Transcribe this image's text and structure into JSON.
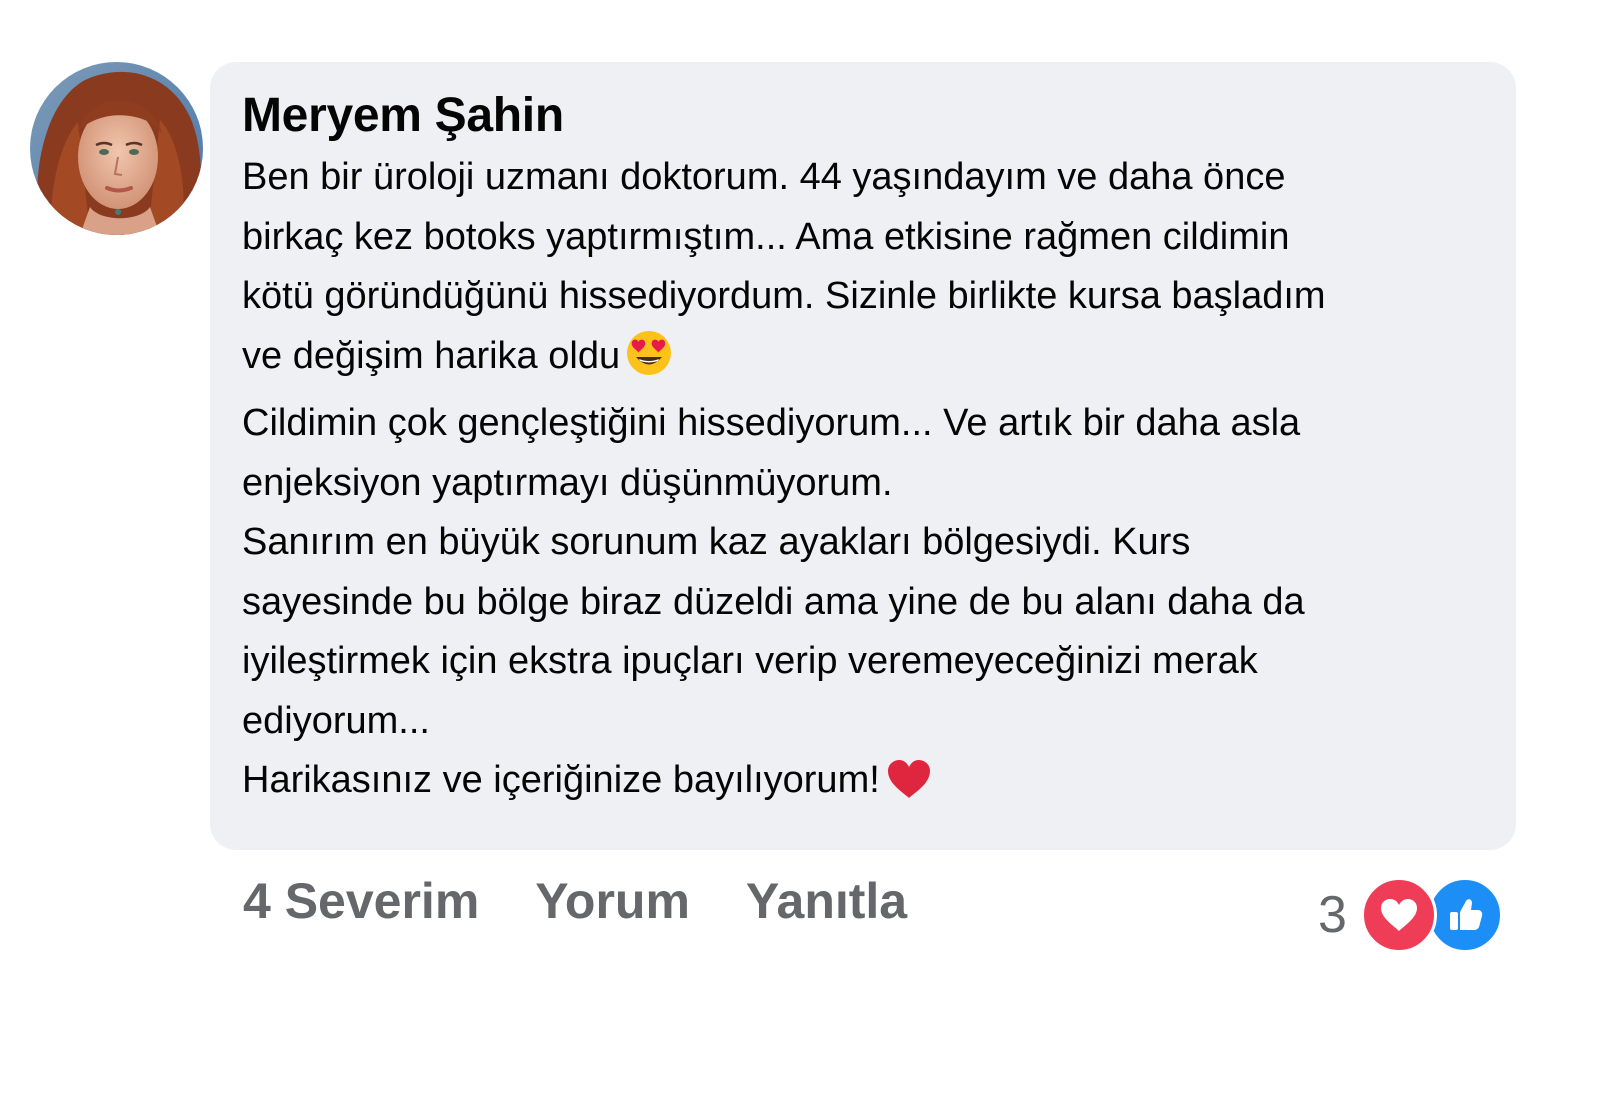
{
  "comment": {
    "author": "Meryem Şahin",
    "lines": [
      "Ben bir üroloji uzmanı doktorum. 44 yaşındayım ve daha önce",
      "birkaç kez botoks yaptırmıştım... Ama etkisine rağmen cildimin",
      "kötü göründüğünü hissediyordum. Sizinle birlikte kursa başladım",
      "ve değişim harika oldu",
      " Cildimin çok gençleştiğini hissediyorum... Ve artık bir daha asla",
      "enjeksiyon yaptırmayı düşünmüyorum.",
      " Sanırım en büyük sorunum kaz ayakları bölgesiydi. Kurs",
      "sayesinde bu bölge biraz düzeldi ama yine de bu alanı daha da",
      "iyileştirmek için ekstra ipuçları verip veremeyeceğinizi merak",
      "ediyorum...",
      "Harikasınız ve içeriğinize bayılıyorum!"
    ],
    "emojis": {
      "line_4": "heart-eyes-emoji",
      "line_11": "red-heart-emoji"
    }
  },
  "actions": {
    "like": "4 Severim",
    "comment": "Yorum",
    "reply": "Yanıtla"
  },
  "reactions": {
    "count": "3",
    "icons": [
      "love-reaction-icon",
      "like-reaction-icon"
    ]
  },
  "colors": {
    "bubble_bg": "#eff0f3",
    "action_text": "#65676b",
    "love": "#ef3d58",
    "like": "#1c8ef5"
  }
}
